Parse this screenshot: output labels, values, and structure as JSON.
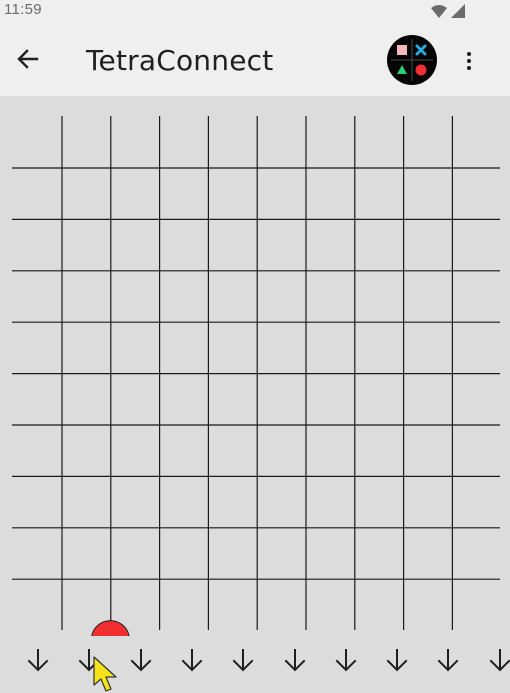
{
  "status_bar": {
    "time": "11:59"
  },
  "app_bar": {
    "back_icon": "arrow-left-icon",
    "title": "TetraConnect",
    "player_icon": "player-symbols-icon",
    "menu_icon": "more-vertical-icon"
  },
  "board": {
    "columns": 10,
    "rows": 10,
    "pieces": [
      {
        "column": 2,
        "row_from_bottom": 1,
        "color": "#f03030",
        "shape": "circle"
      }
    ]
  },
  "colors": {
    "background": "#dcdcdc",
    "app_bar": "#efefef",
    "grid_line": "#1a1a1a",
    "red_piece": "#f03030",
    "pink_square": "#f4b8b8",
    "blue_cross": "#2aa8e0",
    "green_triangle": "#2ecc71"
  },
  "drop_row": {
    "icon": "arrow-down-icon",
    "count": 10
  }
}
